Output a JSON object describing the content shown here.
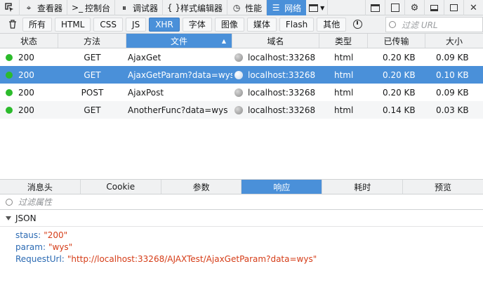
{
  "toolbar": {
    "tabs": [
      {
        "label": "查看器",
        "icon": "inspector-icon"
      },
      {
        "label": "控制台",
        "icon": "console-icon"
      },
      {
        "label": "调试器",
        "icon": "debugger-icon"
      },
      {
        "label": "样式编辑器",
        "icon": "style-editor-icon"
      },
      {
        "label": "性能",
        "icon": "performance-icon"
      },
      {
        "label": "网络",
        "icon": "network-icon"
      }
    ],
    "active_tab": "网络"
  },
  "filters": {
    "buttons": [
      "所有",
      "HTML",
      "CSS",
      "JS",
      "XHR",
      "字体",
      "图像",
      "媒体",
      "Flash",
      "其他"
    ],
    "active": "XHR",
    "search_placeholder": "过滤 URL"
  },
  "requests": {
    "columns": [
      "状态",
      "方法",
      "文件",
      "域名",
      "类型",
      "已传输",
      "大小"
    ],
    "sorted_column": "文件",
    "rows": [
      {
        "status": "200",
        "method": "GET",
        "file": "AjaxGet",
        "domain": "localhost:33268",
        "type": "html",
        "transferred": "0.20 KB",
        "size": "0.09 KB"
      },
      {
        "status": "200",
        "method": "GET",
        "file": "AjaxGetParam?data=wys",
        "domain": "localhost:33268",
        "type": "html",
        "transferred": "0.20 KB",
        "size": "0.10 KB"
      },
      {
        "status": "200",
        "method": "POST",
        "file": "AjaxPost",
        "domain": "localhost:33268",
        "type": "html",
        "transferred": "0.20 KB",
        "size": "0.09 KB"
      },
      {
        "status": "200",
        "method": "GET",
        "file": "AnotherFunc?data=wys",
        "domain": "localhost:33268",
        "type": "html",
        "transferred": "0.14 KB",
        "size": "0.03 KB"
      }
    ],
    "selected_index": 1
  },
  "details": {
    "tabs": [
      "消息头",
      "Cookie",
      "参数",
      "响应",
      "耗时",
      "预览"
    ],
    "active_tab": "响应",
    "filter_placeholder": "过滤属性",
    "section": "JSON",
    "json": [
      {
        "key": "staus",
        "value": "\"200\""
      },
      {
        "key": "param",
        "value": "\"wys\""
      },
      {
        "key": "RequestUrl",
        "value": "\"http://localhost:33268/AJAXTest/AjaxGetParam?data=wys\""
      }
    ]
  },
  "colors": {
    "accent": "#4a90d9",
    "status_ok": "#2cbb2c",
    "json_key": "#2b6ab3",
    "json_string": "#d53c17"
  }
}
